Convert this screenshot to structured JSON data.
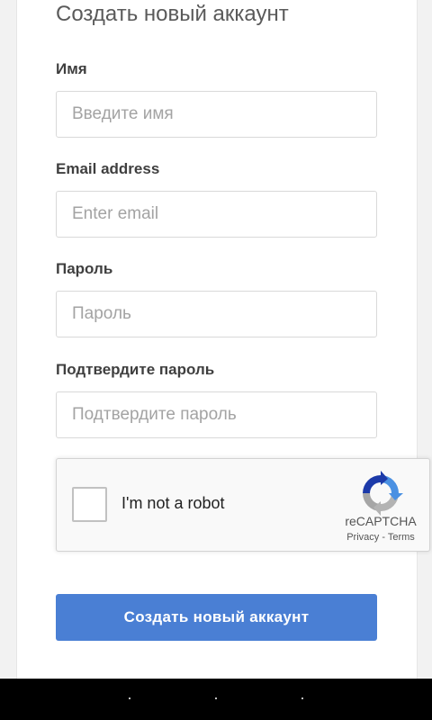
{
  "form": {
    "heading": "Создать новый аккаунт",
    "name": {
      "label": "Имя",
      "placeholder": "Введите имя"
    },
    "email": {
      "label": "Email address",
      "placeholder": "Enter email"
    },
    "password": {
      "label": "Пароль",
      "placeholder": "Пароль"
    },
    "confirm": {
      "label": "Подтвердите пароль",
      "placeholder": "Подтвердите пароль"
    },
    "submit_label": "Создать новый аккаунт",
    "accent_color": "#4a7fd4"
  },
  "captcha": {
    "checkbox_label": "I'm not a robot",
    "brand": "reCAPTCHA",
    "privacy": "Privacy",
    "separator": " - ",
    "terms": "Terms",
    "icon": "recaptcha-logo-icon"
  },
  "system_nav": {
    "buttons": [
      "back",
      "home",
      "recents"
    ]
  }
}
